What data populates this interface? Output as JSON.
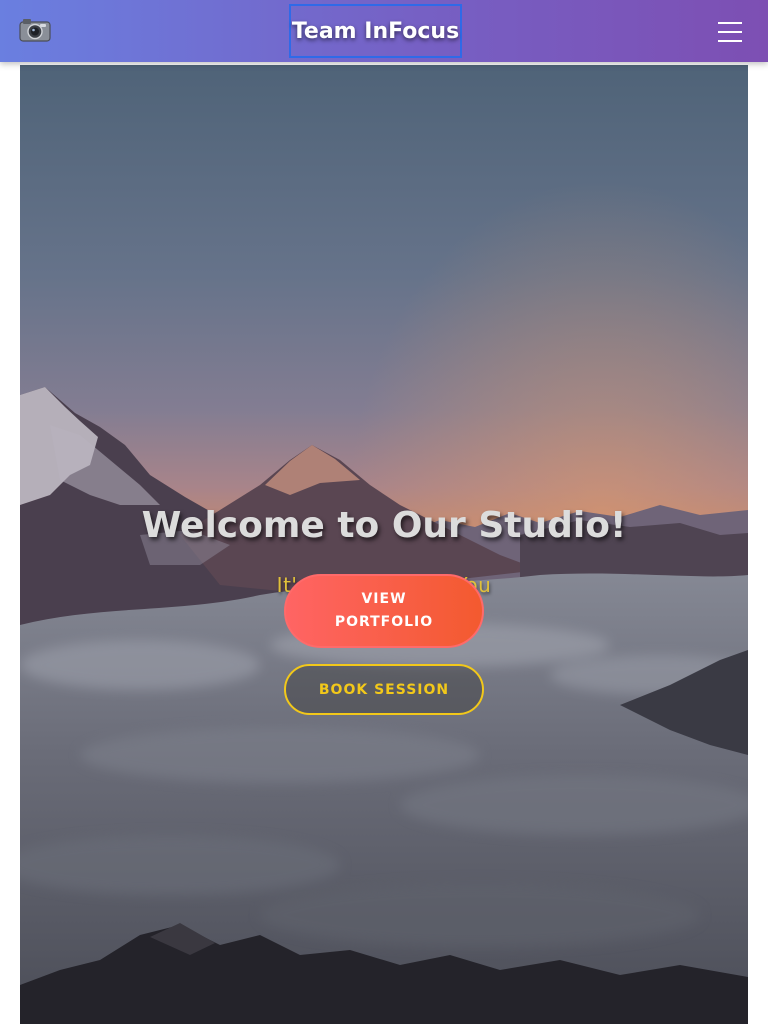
{
  "header": {
    "logo_icon": "camera-icon",
    "brand": "Team InFocus",
    "menu_icon": "hamburger-menu-icon"
  },
  "hero": {
    "title": "Welcome to Our Studio!",
    "subtitle": "It's Nice To Meet You",
    "primary_button": "VIEW PORTFOLIO",
    "secondary_button": "BOOK SESSION"
  },
  "colors": {
    "header_start": "#6a7fe0",
    "header_end": "#7d4fb3",
    "brand_outline": "#2f6ae8",
    "primary_button_start": "#ff6464",
    "primary_button_end": "#f35a2f",
    "secondary_accent": "#f2c81a",
    "subtitle": "#e0c03a"
  }
}
